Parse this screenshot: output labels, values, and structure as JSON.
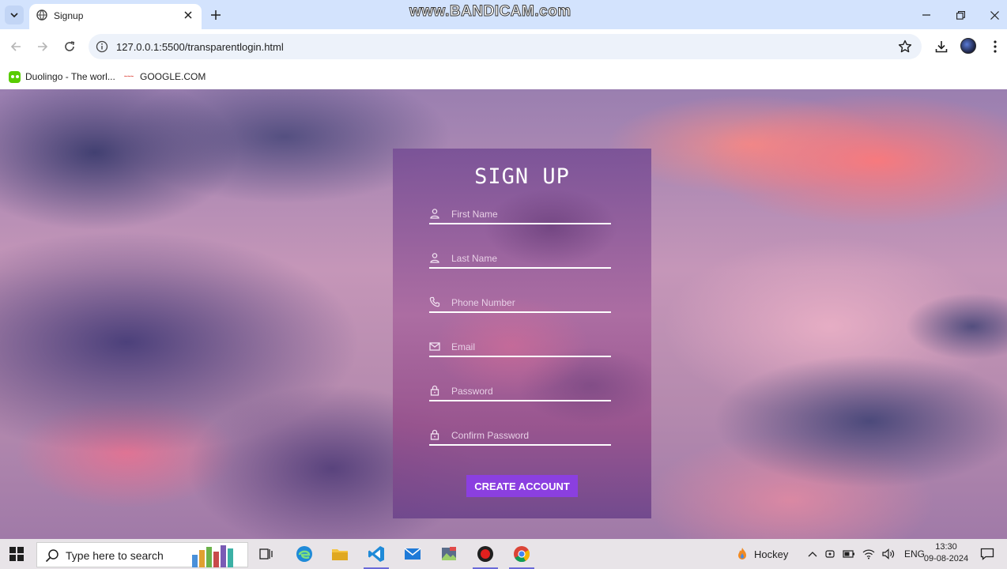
{
  "browser": {
    "tab_title": "Signup",
    "url": "127.0.0.1:5500/transparentlogin.html",
    "watermark": "www.BANDICAM.com"
  },
  "bookmarks": [
    {
      "label": "Duolingo - The worl..."
    },
    {
      "label": "GOOGLE.COM"
    }
  ],
  "signup": {
    "title": "SIGN UP",
    "fields": [
      {
        "placeholder": "First Name",
        "icon": "user-icon"
      },
      {
        "placeholder": "Last Name",
        "icon": "user-icon"
      },
      {
        "placeholder": "Phone Number",
        "icon": "phone-icon"
      },
      {
        "placeholder": "Email",
        "icon": "mail-icon"
      },
      {
        "placeholder": "Password",
        "icon": "lock-icon"
      },
      {
        "placeholder": "Confirm Password",
        "icon": "lock-icon"
      }
    ],
    "button_label": "CREATE ACCOUNT",
    "button_color": "#8b3fe0"
  },
  "taskbar": {
    "search_placeholder": "Type here to search",
    "weather_label": "Hockey",
    "language": "ENG",
    "time": "13:30",
    "date": "09-08-2024"
  }
}
